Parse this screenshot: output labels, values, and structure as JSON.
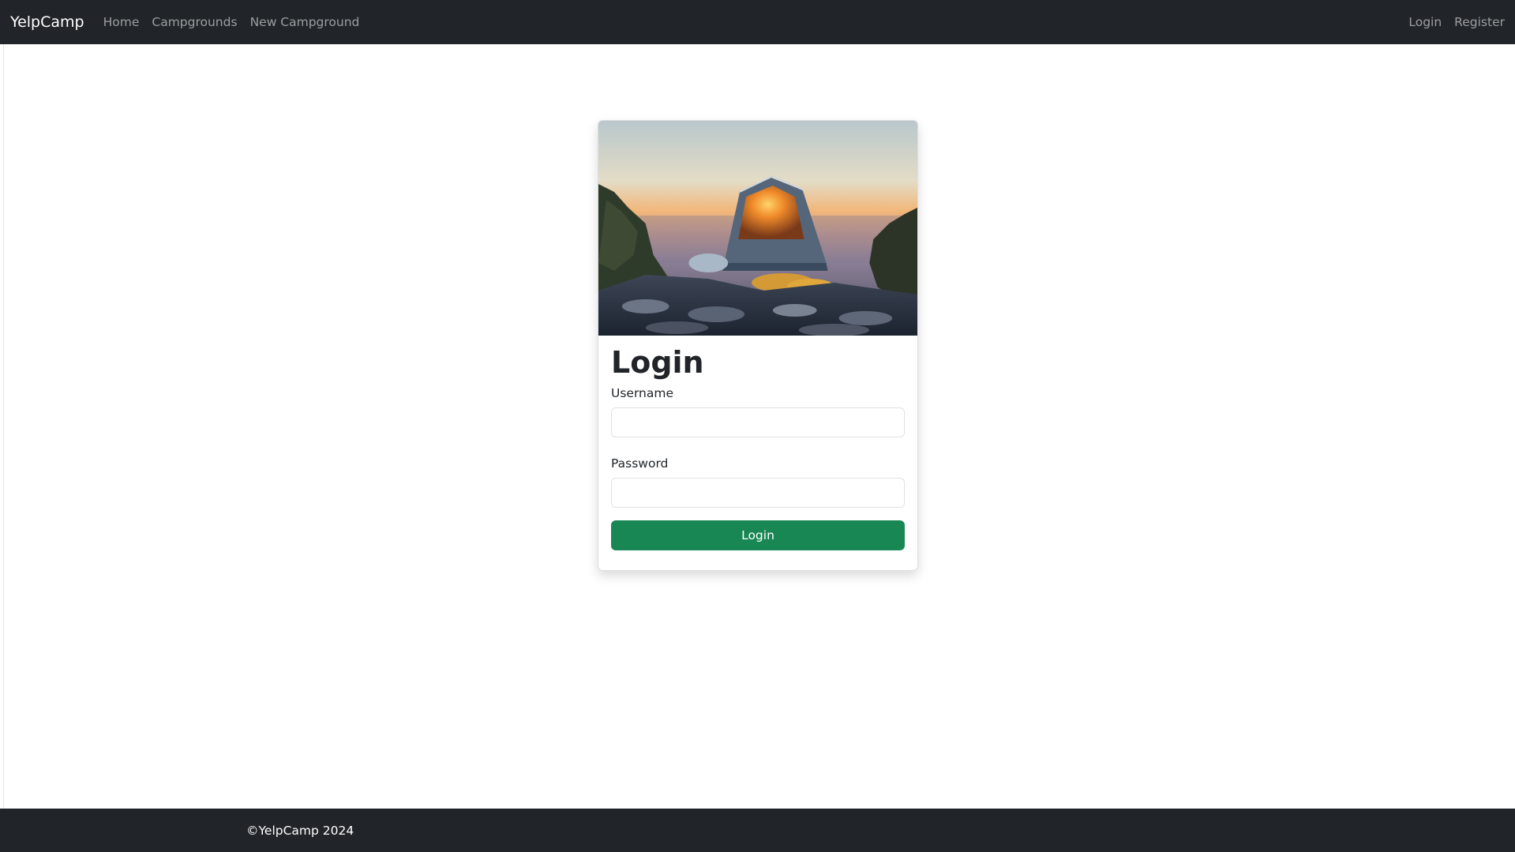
{
  "navbar": {
    "brand": "YelpCamp",
    "links": [
      "Home",
      "Campgrounds",
      "New Campground"
    ],
    "right_links": [
      "Login",
      "Register"
    ],
    "bg_color": "#212529"
  },
  "card": {
    "image_alt": "tent-at-sunset-image",
    "title": "Login",
    "username_label": "Username",
    "username_value": "",
    "password_label": "Password",
    "password_value": "",
    "submit_label": "Login",
    "button_color": "#198754"
  },
  "footer": {
    "text": "©YelpCamp 2024"
  }
}
